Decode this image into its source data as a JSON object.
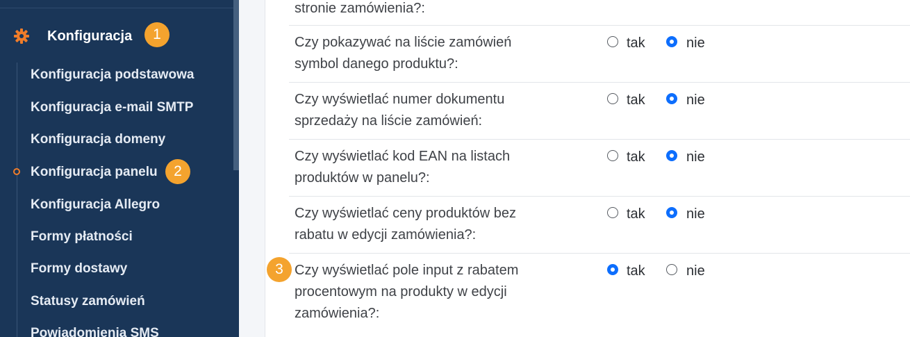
{
  "sidebar": {
    "section_title": "Konfiguracja",
    "section_badge": "1",
    "active_badge": "2",
    "items": [
      {
        "label": "Konfiguracja podstawowa"
      },
      {
        "label": "Konfiguracja e-mail SMTP"
      },
      {
        "label": "Konfiguracja domeny"
      },
      {
        "label": "Konfiguracja panelu"
      },
      {
        "label": "Konfiguracja Allegro"
      },
      {
        "label": "Formy płatności"
      },
      {
        "label": "Formy dostawy"
      },
      {
        "label": "Statusy zamówień"
      },
      {
        "label": "Powiadomienia SMS"
      }
    ],
    "active_index": 3,
    "colors": {
      "background": "#1a3658",
      "accent": "#f07d2a",
      "badge": "#f4a32e"
    }
  },
  "settings": {
    "partial_question": "stronie zamówienia?:",
    "yes_label": "tak",
    "no_label": "nie",
    "highlight_badge": "3",
    "questions": [
      {
        "line1": "Czy pokazywać na liście zamówień",
        "line2": "symbol danego produktu?:",
        "line3": "",
        "selected": "nie"
      },
      {
        "line1": "Czy wyświetlać numer dokumentu",
        "line2": "sprzedaży na liście zamówień:",
        "line3": "",
        "selected": "nie"
      },
      {
        "line1": "Czy wyświetlać kod EAN na listach",
        "line2": "produktów w panelu?:",
        "line3": "",
        "selected": "nie"
      },
      {
        "line1": "Czy wyświetlać ceny produktów bez",
        "line2": "rabatu w edycji zamówienia?:",
        "line3": "",
        "selected": "nie"
      },
      {
        "line1": "Czy wyświetlać pole input z rabatem",
        "line2": "procentowym na produkty w edycji",
        "line3": "zamówienia?:",
        "selected": "tak"
      }
    ],
    "colors": {
      "radio_checked": "#0d6efd"
    }
  }
}
